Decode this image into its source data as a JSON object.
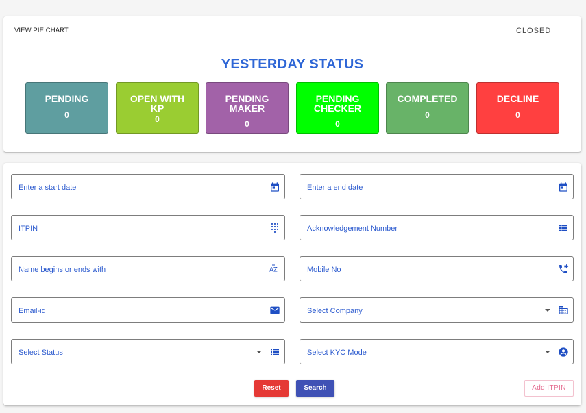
{
  "header": {
    "view_pie_chart": "VIEW PIE CHART",
    "closed": "CLOSED",
    "title": "YESTERDAY STATUS"
  },
  "tiles": [
    {
      "label_lines": [
        "PENDING"
      ],
      "count": "0",
      "color": "#5f9ea0"
    },
    {
      "label_lines": [
        "OPEN WITH",
        "KP"
      ],
      "count": "0",
      "color": "#9acd32"
    },
    {
      "label_lines": [
        "PENDING",
        "MAKER"
      ],
      "count": "0",
      "color": "#a262a8"
    },
    {
      "label_lines": [
        "PENDING",
        "CHECKER"
      ],
      "count": "0",
      "color": "#00ff00"
    },
    {
      "label_lines": [
        "COMPLETED"
      ],
      "count": "0",
      "color": "#68b368"
    },
    {
      "label_lines": [
        "DECLINE"
      ],
      "count": "0",
      "color": "#ff4040"
    }
  ],
  "form": {
    "start_date": {
      "placeholder": "Enter a start date",
      "icon": "calendar-icon"
    },
    "end_date": {
      "placeholder": "Enter a end date",
      "icon": "calendar-icon"
    },
    "itpin": {
      "placeholder": "ITPIN",
      "icon": "dialpad-icon"
    },
    "ack_number": {
      "placeholder": "Acknowledgement Number",
      "icon": "list-icon"
    },
    "name": {
      "placeholder": "Name begins or ends with",
      "icon": "sort-az-icon"
    },
    "mobile": {
      "placeholder": "Mobile No",
      "icon": "phone-forwarded-icon"
    },
    "email": {
      "placeholder": "Email-id",
      "icon": "mail-icon"
    },
    "company": {
      "placeholder": "Select Company",
      "icon": "building-icon"
    },
    "status": {
      "placeholder": "Select Status",
      "icon": "list-icon"
    },
    "kyc_mode": {
      "placeholder": "Select KYC Mode",
      "icon": "account-circle-icon"
    }
  },
  "actions": {
    "reset": "Reset",
    "search": "Search",
    "add_itpin": "Add ITPIN"
  },
  "colors": {
    "accent": "#2e66d6",
    "reset": "#e53935",
    "search": "#3f51b5",
    "add_itpin": "#e46a8e"
  }
}
